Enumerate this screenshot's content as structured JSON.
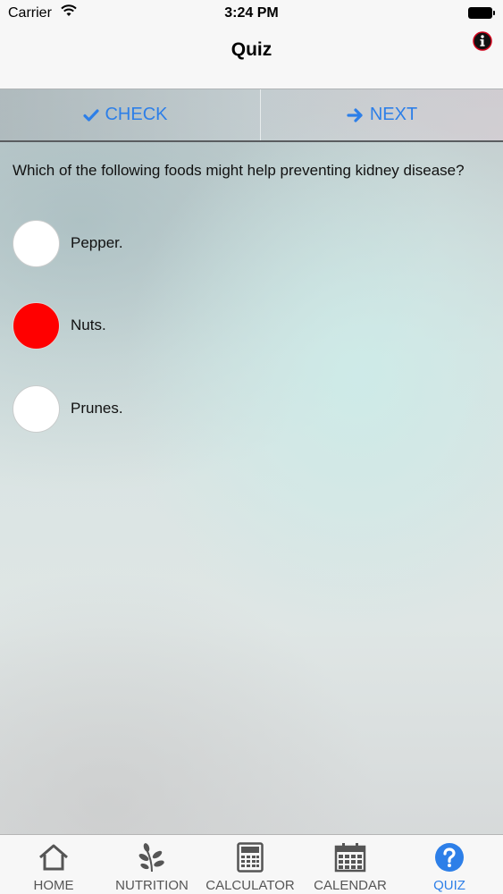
{
  "status_bar": {
    "carrier": "Carrier",
    "time": "3:24 PM"
  },
  "nav": {
    "title": "Quiz",
    "info_icon": "info-icon"
  },
  "actions": {
    "check_label": "CHECK",
    "next_label": "NEXT"
  },
  "quiz": {
    "question": "Which of the following foods might help preventing kidney disease?",
    "options": [
      {
        "label": "Pepper.",
        "selected": false
      },
      {
        "label": "Nuts.",
        "selected": true
      },
      {
        "label": "Prunes.",
        "selected": false
      }
    ]
  },
  "tabs": [
    {
      "label": "HOME",
      "icon": "home-icon",
      "active": false
    },
    {
      "label": "NUTRITION",
      "icon": "leaf-icon",
      "active": false
    },
    {
      "label": "CALCULATOR",
      "icon": "calculator-icon",
      "active": false
    },
    {
      "label": "CALENDAR",
      "icon": "calendar-icon",
      "active": false
    },
    {
      "label": "QUIZ",
      "icon": "question-icon",
      "active": true
    }
  ],
  "colors": {
    "accent": "#2d7fe8",
    "selected_option": "#ff0000"
  }
}
